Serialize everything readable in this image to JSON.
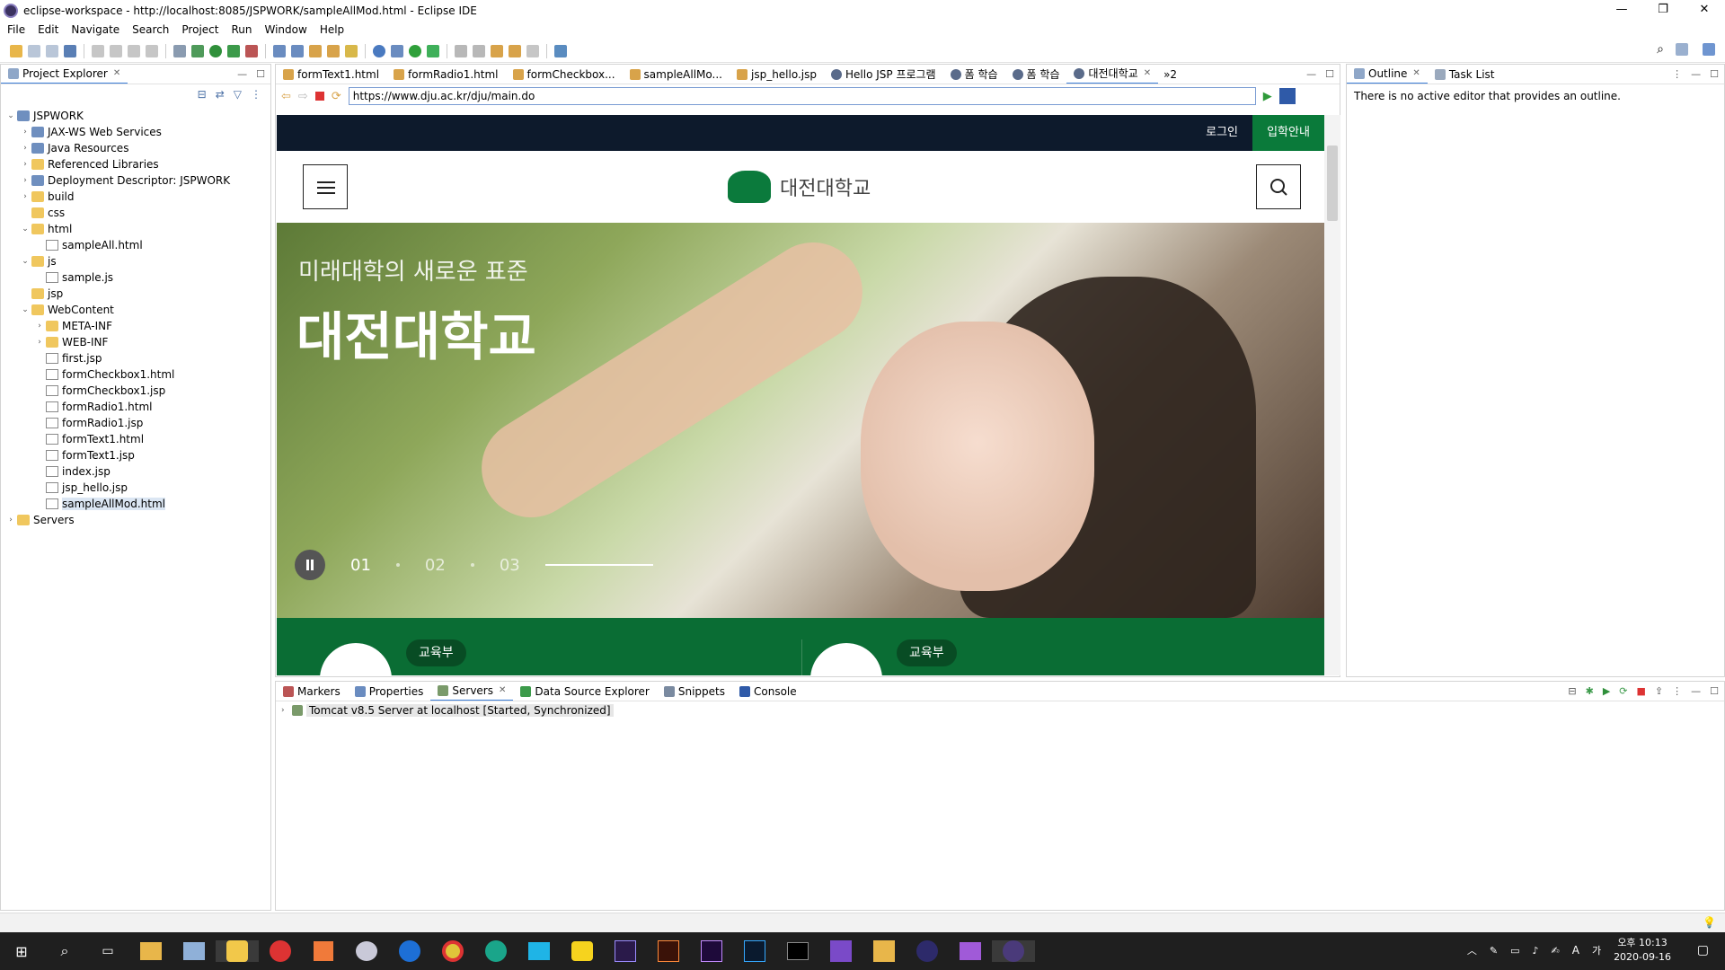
{
  "window": {
    "title": "eclipse-workspace - http://localhost:8085/JSPWORK/sampleAllMod.html - Eclipse IDE"
  },
  "menu": [
    "File",
    "Edit",
    "Navigate",
    "Search",
    "Project",
    "Run",
    "Window",
    "Help"
  ],
  "project_explorer": {
    "title": "Project Explorer",
    "items": [
      {
        "label": "JSPWORK",
        "depth": 0,
        "tw": "v",
        "type": "proj"
      },
      {
        "label": "JAX-WS Web Services",
        "depth": 1,
        "tw": ">",
        "type": "proj"
      },
      {
        "label": "Java Resources",
        "depth": 1,
        "tw": ">",
        "type": "proj"
      },
      {
        "label": "Referenced Libraries",
        "depth": 1,
        "tw": ">",
        "type": "folder"
      },
      {
        "label": "Deployment Descriptor: JSPWORK",
        "depth": 1,
        "tw": ">",
        "type": "proj"
      },
      {
        "label": "build",
        "depth": 1,
        "tw": ">",
        "type": "folder"
      },
      {
        "label": "css",
        "depth": 1,
        "tw": "",
        "type": "folder"
      },
      {
        "label": "html",
        "depth": 1,
        "tw": "v",
        "type": "folder"
      },
      {
        "label": "sampleAll.html",
        "depth": 2,
        "tw": "",
        "type": "file"
      },
      {
        "label": "js",
        "depth": 1,
        "tw": "v",
        "type": "folder"
      },
      {
        "label": "sample.js",
        "depth": 2,
        "tw": "",
        "type": "file"
      },
      {
        "label": "jsp",
        "depth": 1,
        "tw": "",
        "type": "folder"
      },
      {
        "label": "WebContent",
        "depth": 1,
        "tw": "v",
        "type": "folder"
      },
      {
        "label": "META-INF",
        "depth": 2,
        "tw": ">",
        "type": "folder"
      },
      {
        "label": "WEB-INF",
        "depth": 2,
        "tw": ">",
        "type": "folder"
      },
      {
        "label": "first.jsp",
        "depth": 2,
        "tw": "",
        "type": "file"
      },
      {
        "label": "formCheckbox1.html",
        "depth": 2,
        "tw": "",
        "type": "file"
      },
      {
        "label": "formCheckbox1.jsp",
        "depth": 2,
        "tw": "",
        "type": "file"
      },
      {
        "label": "formRadio1.html",
        "depth": 2,
        "tw": "",
        "type": "file"
      },
      {
        "label": "formRadio1.jsp",
        "depth": 2,
        "tw": "",
        "type": "file"
      },
      {
        "label": "formText1.html",
        "depth": 2,
        "tw": "",
        "type": "file"
      },
      {
        "label": "formText1.jsp",
        "depth": 2,
        "tw": "",
        "type": "file"
      },
      {
        "label": "index.jsp",
        "depth": 2,
        "tw": "",
        "type": "file"
      },
      {
        "label": "jsp_hello.jsp",
        "depth": 2,
        "tw": "",
        "type": "file"
      },
      {
        "label": "sampleAllMod.html",
        "depth": 2,
        "tw": "",
        "type": "file",
        "selected": true
      },
      {
        "label": "Servers",
        "depth": 0,
        "tw": ">",
        "type": "folder"
      }
    ]
  },
  "editor_tabs": [
    "formText1.html",
    "formRadio1.html",
    "formCheckbox...",
    "sampleAllMo...",
    "jsp_hello.jsp",
    "Hello JSP 프로그램",
    "폼 학습",
    "폼 학습",
    "대전대학교"
  ],
  "editor_tabs_overflow": "»2",
  "browser": {
    "url": "https://www.dju.ac.kr/dju/main.do"
  },
  "web": {
    "login": "로그인",
    "admission": "입학안내",
    "logo_text": "대전대학교",
    "hero_subtitle": "미래대학의 새로운 표준",
    "hero_title": "대전대학교",
    "pager": [
      "01",
      "02",
      "03"
    ],
    "badge1": "교육부",
    "badge2": "교육부"
  },
  "outline": {
    "tab": "Outline",
    "tab2": "Task List",
    "message": "There is no active editor that provides an outline."
  },
  "bottom": {
    "tabs": [
      "Markers",
      "Properties",
      "Servers",
      "Data Source Explorer",
      "Snippets",
      "Console"
    ],
    "server_row": "Tomcat v8.5 Server at localhost  [Started, Synchronized]"
  },
  "taskbar": {
    "time": "오후 10:13",
    "date": "2020-09-16"
  },
  "colors": {
    "accent": "#3b7dd8",
    "dju_green": "#0a7a3a",
    "taskbar": "#1f1f1f"
  }
}
